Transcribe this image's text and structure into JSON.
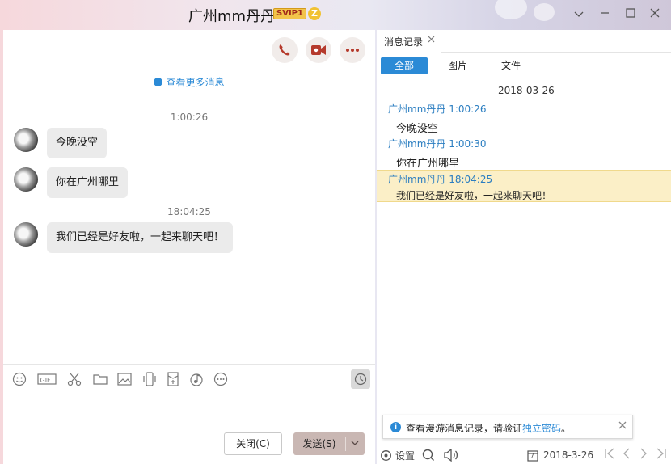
{
  "window": {
    "contact_name": "广州mm丹丹",
    "svip_badge": "SVIP1",
    "z_badge": "Z",
    "controls": {
      "minimize": "—",
      "maximize": "□",
      "close": "✕",
      "dropdown": "⌄"
    }
  },
  "chat": {
    "load_more": "查看更多消息",
    "messages": [
      {
        "time": "1:00:26",
        "text": "今晚没空"
      },
      {
        "time": "",
        "text": "你在广州哪里"
      },
      {
        "time": "18:04:25",
        "text": "我们已经是好友啦，一起来聊天吧！"
      }
    ],
    "toolbar_icons": [
      "emoji-icon",
      "gif-icon",
      "scissors-icon",
      "folder-icon",
      "image-icon",
      "shake-icon",
      "red-packet-icon",
      "music-icon",
      "more-icon"
    ],
    "close_label": "关闭(C)",
    "send_label": "发送(S)"
  },
  "history": {
    "tab_label": "消息记录",
    "filters": [
      "全部",
      "图片",
      "文件"
    ],
    "active_filter": "全部",
    "date": "2018-03-26",
    "entries": [
      {
        "header": "广州mm丹丹 1:00:26",
        "text": "今晚没空"
      },
      {
        "header": "广州mm丹丹 1:00:30",
        "text": "你在广州哪里"
      },
      {
        "header": "广州mm丹丹 18:04:25",
        "text": "我们已经是好友啦，一起来聊天吧！"
      }
    ],
    "notice": {
      "prefix": "查看漫游消息记录，请验证",
      "link": "独立密码",
      "suffix": "。"
    },
    "bottom": {
      "settings_label": "设置",
      "calendar_day": "7",
      "date": "2018-3-26"
    }
  },
  "colors": {
    "accent": "#2b8ad6",
    "highlight": "#fbefc7",
    "send_button": "#c9b7b3",
    "sender": "#2b7ec1"
  }
}
